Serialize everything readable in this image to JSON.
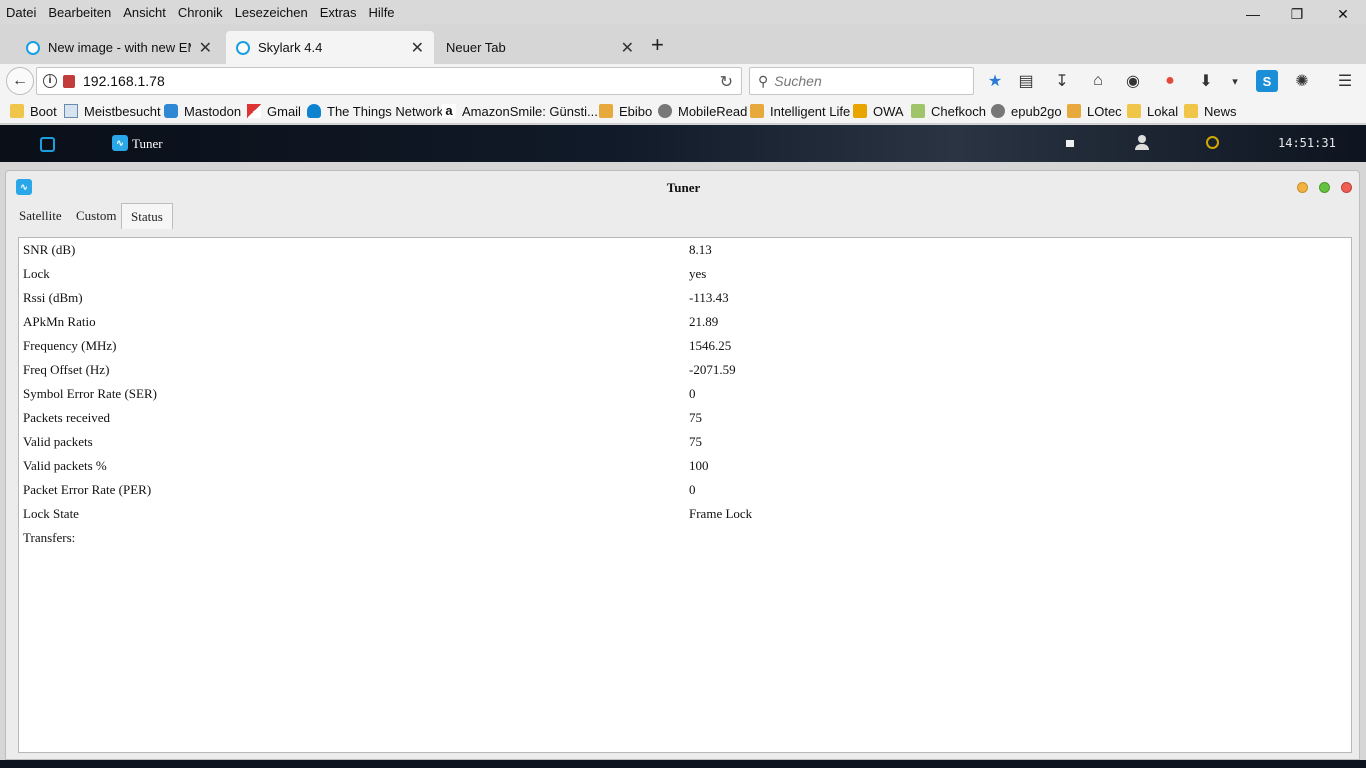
{
  "browser": {
    "menu": [
      "Datei",
      "Bearbeiten",
      "Ansicht",
      "Chronik",
      "Lesezeichen",
      "Extras",
      "Hilfe"
    ],
    "tabs": [
      {
        "title": "New image - with new EMEA",
        "active": false
      },
      {
        "title": "Skylark 4.4",
        "active": true
      },
      {
        "title": "Neuer Tab",
        "active": false
      }
    ],
    "url": "192.168.1.78",
    "search_placeholder": "Suchen",
    "bookmarks": [
      {
        "label": "Boot",
        "icon": "folder-icon"
      },
      {
        "label": "Meistbesucht",
        "icon": "page-icon"
      },
      {
        "label": "Mastodon",
        "icon": "mastodon-icon"
      },
      {
        "label": "Gmail",
        "icon": "gmail-icon"
      },
      {
        "label": "The Things Network",
        "icon": "ttn-icon"
      },
      {
        "label": "AmazonSmile: Günsti...",
        "icon": "amazon-icon"
      },
      {
        "label": "Ebibo",
        "icon": "rss-icon"
      },
      {
        "label": "MobileRead",
        "icon": "globe-icon"
      },
      {
        "label": "Intelligent Life",
        "icon": "rss-icon"
      },
      {
        "label": "OWA",
        "icon": "owa-icon"
      },
      {
        "label": "Chefkoch",
        "icon": "chefkoch-icon"
      },
      {
        "label": "epub2go",
        "icon": "globe-icon"
      },
      {
        "label": "LOtec",
        "icon": "rss-icon"
      },
      {
        "label": "Lokal",
        "icon": "folder-icon"
      },
      {
        "label": "News",
        "icon": "folder-icon"
      }
    ]
  },
  "appbar": {
    "app_label": "Tuner",
    "clock": "14:51:31"
  },
  "window": {
    "title": "Tuner",
    "tabs": [
      {
        "label": "Satellite",
        "active": false
      },
      {
        "label": "Custom",
        "active": false
      },
      {
        "label": "Status",
        "active": true
      }
    ],
    "status_rows": [
      {
        "label": "SNR (dB)",
        "value": "8.13"
      },
      {
        "label": "Lock",
        "value": "yes"
      },
      {
        "label": "Rssi (dBm)",
        "value": "-113.43"
      },
      {
        "label": "APkMn Ratio",
        "value": "21.89"
      },
      {
        "label": "Frequency (MHz)",
        "value": "1546.25"
      },
      {
        "label": "Freq Offset (Hz)",
        "value": "-2071.59"
      },
      {
        "label": "Symbol Error Rate (SER)",
        "value": "0"
      },
      {
        "label": "Packets received",
        "value": "75"
      },
      {
        "label": "Valid packets",
        "value": "75"
      },
      {
        "label": "Valid packets %",
        "value": "100"
      },
      {
        "label": "Packet Error Rate (PER)",
        "value": "0"
      },
      {
        "label": "Lock State",
        "value": "Frame Lock"
      },
      {
        "label": "Transfers:",
        "value": ""
      }
    ]
  }
}
